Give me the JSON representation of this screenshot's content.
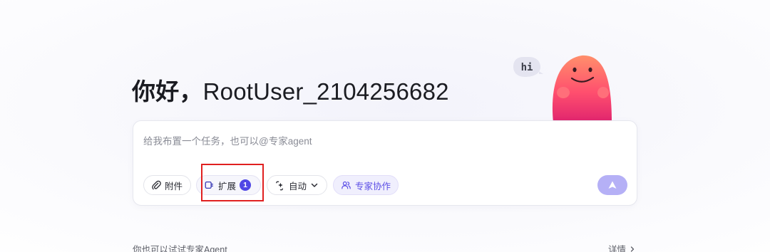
{
  "header": {
    "greeting_word": "你好，",
    "username": "RootUser_2104256682"
  },
  "mascot": {
    "bubble_text": "hi"
  },
  "composer": {
    "placeholder": "给我布置一个任务，也可以@专家agent",
    "toolbar": {
      "attach_label": "附件",
      "extensions_label": "扩展",
      "extensions_count": "1",
      "mode_label": "自动",
      "expert_label": "专家协作"
    }
  },
  "footer": {
    "hint": "你也可以试试专家Agent",
    "details_label": "详情"
  },
  "colors": {
    "accent": "#4f46e5",
    "send_button": "#b5b0f6",
    "highlight": "#e02020"
  }
}
